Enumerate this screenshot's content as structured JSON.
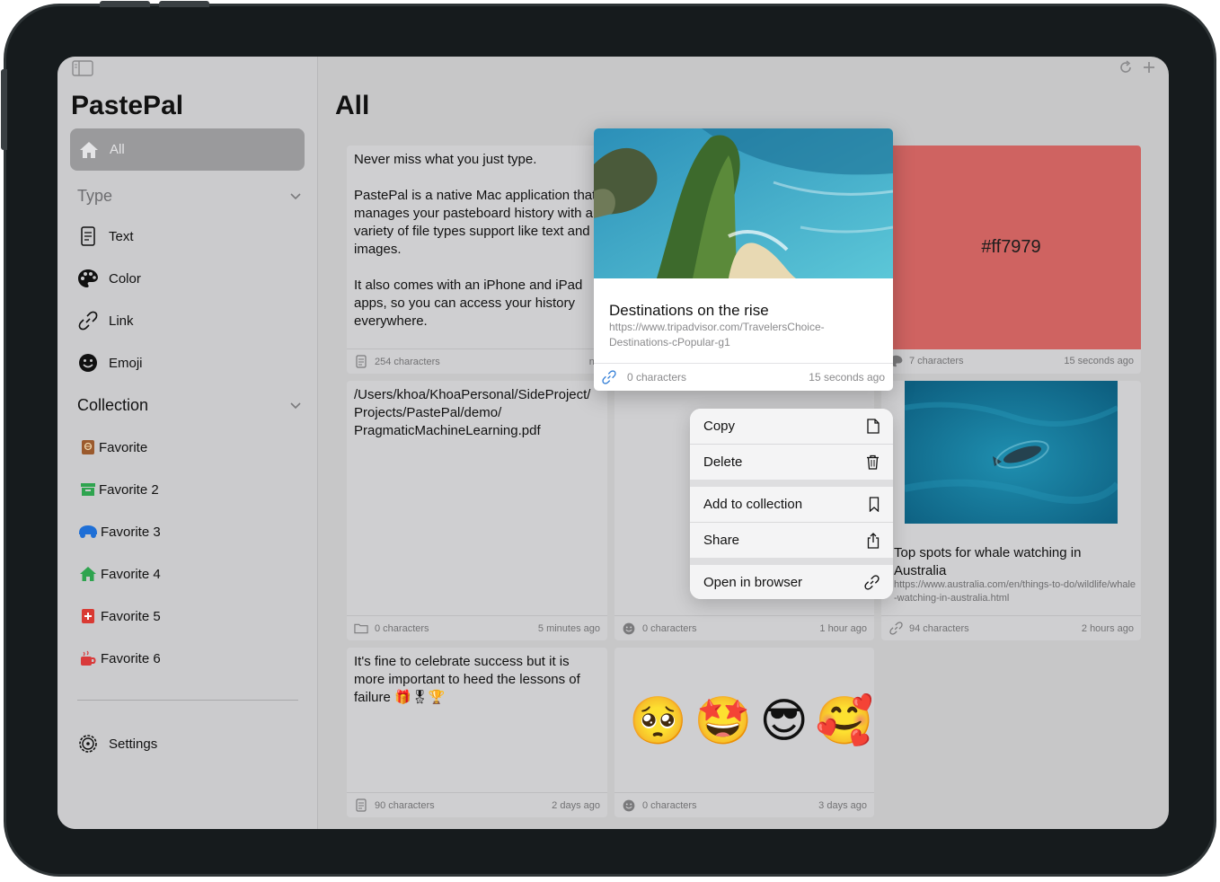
{
  "app": {
    "title": "PastePal"
  },
  "sidebar": {
    "all_label": "All",
    "type_section": "Type",
    "type_items": [
      {
        "label": "Text",
        "icon": "text-doc-icon"
      },
      {
        "label": "Color",
        "icon": "palette-icon"
      },
      {
        "label": "Link",
        "icon": "link-icon"
      },
      {
        "label": "Emoji",
        "icon": "emoji-icon"
      }
    ],
    "collection_section": "Collection",
    "collection_items": [
      {
        "label": "Favorite",
        "icon": "book-icon",
        "color": "#9b5a2d"
      },
      {
        "label": "Favorite 2",
        "icon": "archive-box-icon",
        "color": "#2fa44f"
      },
      {
        "label": "Favorite 3",
        "icon": "car-icon",
        "color": "#1f6fd6"
      },
      {
        "label": "Favorite 4",
        "icon": "house-icon",
        "color": "#2fa44f"
      },
      {
        "label": "Favorite 5",
        "icon": "first-aid-icon",
        "color": "#d93a33"
      },
      {
        "label": "Favorite 6",
        "icon": "cup-icon",
        "color": "#d93a3a"
      }
    ],
    "settings_label": "Settings"
  },
  "main": {
    "title": "All",
    "cards": [
      {
        "text": "Never miss what you just type.\n\nPastePal is a native Mac application that\nmanages your pasteboard history with a\nvariety of file types support like text and\nimages.\n\nIt also comes with an iPhone and iPad\napps, so you can access your history\neverywhere.",
        "count": "254 characters",
        "time": "no"
      },
      {
        "color_value": "#ff7979",
        "swatch": "#cf6361",
        "count": "7 characters",
        "time": "15 seconds ago"
      },
      {
        "text": "/Users/khoa/KhoaPersonal/SideProject/\nProjects/PastePal/demo/\nPragmaticMachineLearning.pdf",
        "count": "0 characters",
        "time": "5 minutes ago"
      },
      {
        "count": "0 characters",
        "time": "1 hour ago"
      },
      {
        "title": "Top spots for whale watching in Australia",
        "url": "https://www.australia.com/en/things-to-do/wildlife/whale-watching-in-australia.html",
        "count": "94 characters",
        "time": "2 hours ago"
      },
      {
        "text": "It's fine to celebrate success but it is\nmore important to heed the lessons of\nfailure 🎁🎖🏆",
        "count": "90 characters",
        "time": "2 days ago"
      },
      {
        "emojis": [
          "🥺",
          "🤩",
          "😎",
          "🥰"
        ],
        "count": "0 characters",
        "time": "3 days ago"
      }
    ]
  },
  "preview": {
    "title": "Destinations on the rise",
    "url": "https://www.tripadvisor.com/TravelersChoice-Destinations-cPopular-g1",
    "count": "0 characters",
    "time": "15 seconds ago"
  },
  "context_menu": {
    "items": [
      {
        "label": "Copy",
        "icon": "document-icon"
      },
      {
        "label": "Delete",
        "icon": "trash-icon"
      },
      {
        "label": "Add to collection",
        "icon": "bookmark-icon"
      },
      {
        "label": "Share",
        "icon": "share-icon"
      },
      {
        "label": "Open in browser",
        "icon": "link-icon"
      }
    ]
  }
}
